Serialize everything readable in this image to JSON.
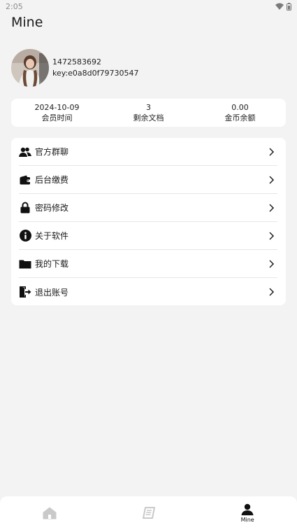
{
  "status_bar": {
    "time": "2:05",
    "icons": [
      "wifi-icon",
      "battery-icon"
    ]
  },
  "header": {
    "title": "Mine"
  },
  "profile": {
    "account": "1472583692",
    "key": "key:e0a8d0f79730547"
  },
  "stats": [
    {
      "value": "2024-10-09",
      "label": "会员时间"
    },
    {
      "value": "3",
      "label": "剩余文档"
    },
    {
      "value": "0.00",
      "label": "金币余额"
    }
  ],
  "menu": [
    {
      "label": "官方群聊",
      "icon": "group-icon"
    },
    {
      "label": "后台缴费",
      "icon": "wallet-icon"
    },
    {
      "label": "密码修改",
      "icon": "lock-icon"
    },
    {
      "label": "关于软件",
      "icon": "info-icon"
    },
    {
      "label": "我的下载",
      "icon": "folder-icon"
    },
    {
      "label": "退出账号",
      "icon": "logout-icon"
    }
  ],
  "bottom_nav": {
    "tabs": [
      {
        "icon": "home-icon",
        "label": ""
      },
      {
        "icon": "book-icon",
        "label": ""
      },
      {
        "icon": "person-icon",
        "label": "Mine",
        "active": true
      }
    ]
  }
}
